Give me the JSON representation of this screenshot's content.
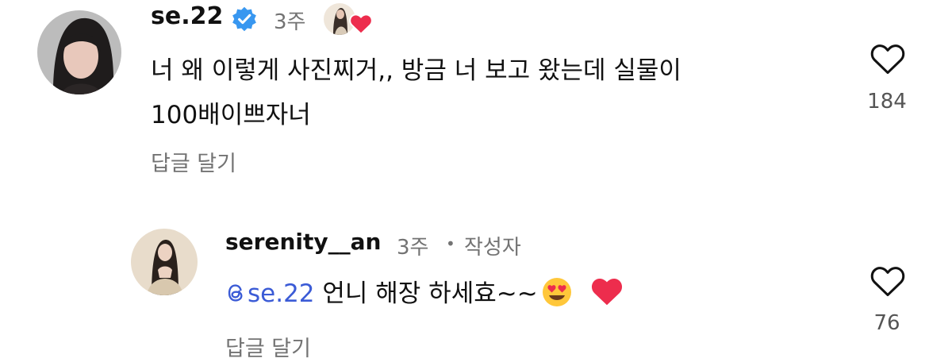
{
  "comments": [
    {
      "username": "se.22",
      "time": "3주",
      "text_line1": "너 왜 이렇게 사진찌거,, 방금 너 보고 왔는데 실물이",
      "text_line2": "100배이쁘자너",
      "reply_label": "답글 달기",
      "like_count": "184"
    },
    {
      "username": "serenity__an",
      "time": "3주",
      "author_label": "작성자",
      "mention": "se.22",
      "text": "언니 해장 하세효~~",
      "emoji1": "😍",
      "emoji2": "❤",
      "reply_label": "답글 달기",
      "like_count": "76"
    }
  ],
  "colors": {
    "verified": "#3897f0",
    "heart": "#ed2d4d",
    "mention": "#3b5bd6",
    "secondary": "#737373"
  },
  "icons": [
    "verified-badge-icon",
    "heart-icon",
    "like-outline-icon",
    "threads-icon"
  ]
}
